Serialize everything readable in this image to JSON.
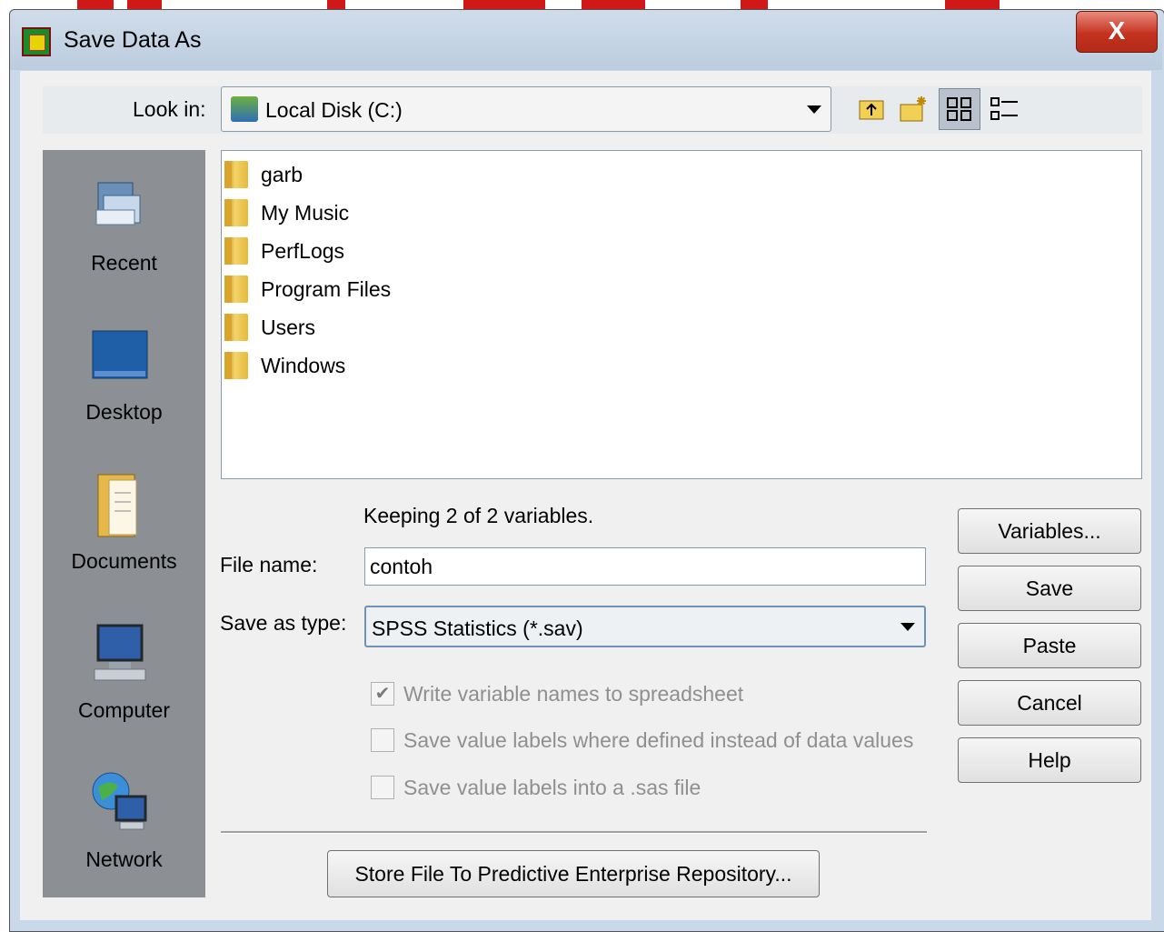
{
  "window": {
    "title": "Save Data As",
    "close_glyph": "X"
  },
  "lookin": {
    "label": "Look in:",
    "value": "Local Disk (C:)"
  },
  "toolbar": {
    "icons": [
      "up-one-level-icon",
      "new-folder-icon",
      "thumbnails-view-icon",
      "details-view-icon"
    ]
  },
  "places": [
    {
      "label": "Recent",
      "icon": "recent-icon"
    },
    {
      "label": "Desktop",
      "icon": "desktop-icon"
    },
    {
      "label": "Documents",
      "icon": "documents-icon"
    },
    {
      "label": "Computer",
      "icon": "computer-icon"
    },
    {
      "label": "Network",
      "icon": "network-icon"
    }
  ],
  "files": [
    "garb",
    "My Music",
    "PerfLogs",
    "Program Files",
    "Users",
    "Windows"
  ],
  "keeping_text": "Keeping 2 of 2 variables.",
  "filename": {
    "label": "File name:",
    "value": "contoh"
  },
  "savetype": {
    "label": "Save as type:",
    "value": "SPSS Statistics (*.sav)"
  },
  "options": [
    {
      "label": "Write variable names to spreadsheet",
      "checked": true
    },
    {
      "label": "Save value labels where defined instead of data values",
      "checked": false
    },
    {
      "label": "Save value labels into a .sas file",
      "checked": false
    }
  ],
  "buttons": {
    "variables": "Variables...",
    "save": "Save",
    "paste": "Paste",
    "cancel": "Cancel",
    "help": "Help",
    "store": "Store File To Predictive Enterprise Repository..."
  },
  "colors": {
    "close_button": "#c4321f",
    "places_bar": "#8c8f93",
    "watermark": "#d01818"
  }
}
